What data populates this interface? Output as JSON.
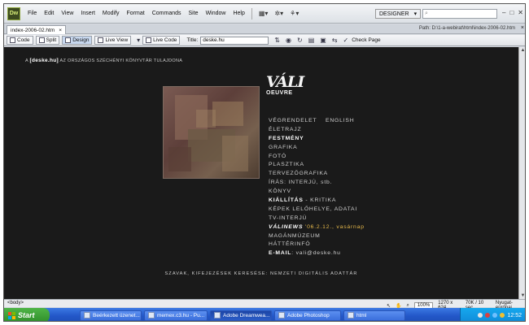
{
  "app": {
    "logo_text": "Dw",
    "menus": [
      "File",
      "Edit",
      "View",
      "Insert",
      "Modify",
      "Format",
      "Commands",
      "Site",
      "Window",
      "Help"
    ],
    "workspace": "DESIGNER",
    "window_controls": [
      "–",
      "□",
      "✕"
    ]
  },
  "document": {
    "tab_label": "index-2006-02.htm",
    "tab_close": "×",
    "path_label": "Path:",
    "path_value": "D:\\1-a-webirat\\html\\index-2006-02.htm",
    "path_close": "×"
  },
  "toolbar": {
    "code_label": "Code",
    "split_label": "Split",
    "design_label": "Design",
    "live_view_label": "Live View",
    "live_code_label": "Live Code",
    "title_label": "Title:",
    "title_value": "deske.hu",
    "check_page_label": "Check Page"
  },
  "page": {
    "owner_prefix": "A",
    "owner_site": "[deske.hu]",
    "owner_suffix": "AZ ORSZÁGOS SZÉCHÉNYI KÖNYVTÁR TULAJDONA",
    "logo_big": "VÁLI",
    "logo_small": "OEUVRE",
    "english": "ENGLISH",
    "menu": {
      "vegrendelet": "VÉGRENDELET",
      "eletrajz": "ÉLETRAJZ",
      "festmeny": "FESTMÉNY",
      "grafika": "GRAFIKA",
      "foto": "FOTÓ",
      "plasztika": "PLASZTIKA",
      "tervezografika": "TERVEZŐGRAFIKA",
      "iras": "ÍRÁS: INTERJÚ, stb.",
      "konyv": "KÖNYV",
      "kiallitas": "KIÁLLÍTÁS",
      "kiallitas_rest": " - KRITIKA",
      "kepek": "KÉPEK LELŐHELYE, ADATAI",
      "tv": "TV-INTERJÚ",
      "valinews": "VÁLINEWS",
      "valinews_date": " '06.2.12., vasárnap",
      "maganmuzeum": "MAGÁNMÚZEUM",
      "hatterinfo": "HÁTTÉRINFÓ",
      "email_label": "E-MAIL",
      "email_value": ": vali@deske.hu"
    },
    "footer": "SZAVAK, KIFEJEZÉSEK KERESÉSE: NEMZETI DIGITÁLIS ADATTÁR"
  },
  "status": {
    "tag": "<body>",
    "zoom": "100%",
    "size": "1270 x 624",
    "download": "70K / 10 sec",
    "encoding": "Nyugat-európai"
  },
  "taskbar": {
    "start_label": "Start",
    "tasks": [
      "Beérkezett üzenet...",
      "memex.c3.hu - Pu...",
      "Adobe Dreamwea...",
      "Adobe Photoshop",
      "html"
    ],
    "clock": "12:52"
  },
  "colors": {
    "page_background": "#1a1a1a",
    "highlight": "#e4b74a",
    "taskbar_blue": "#2357c8",
    "start_green": "#3a9f34"
  }
}
